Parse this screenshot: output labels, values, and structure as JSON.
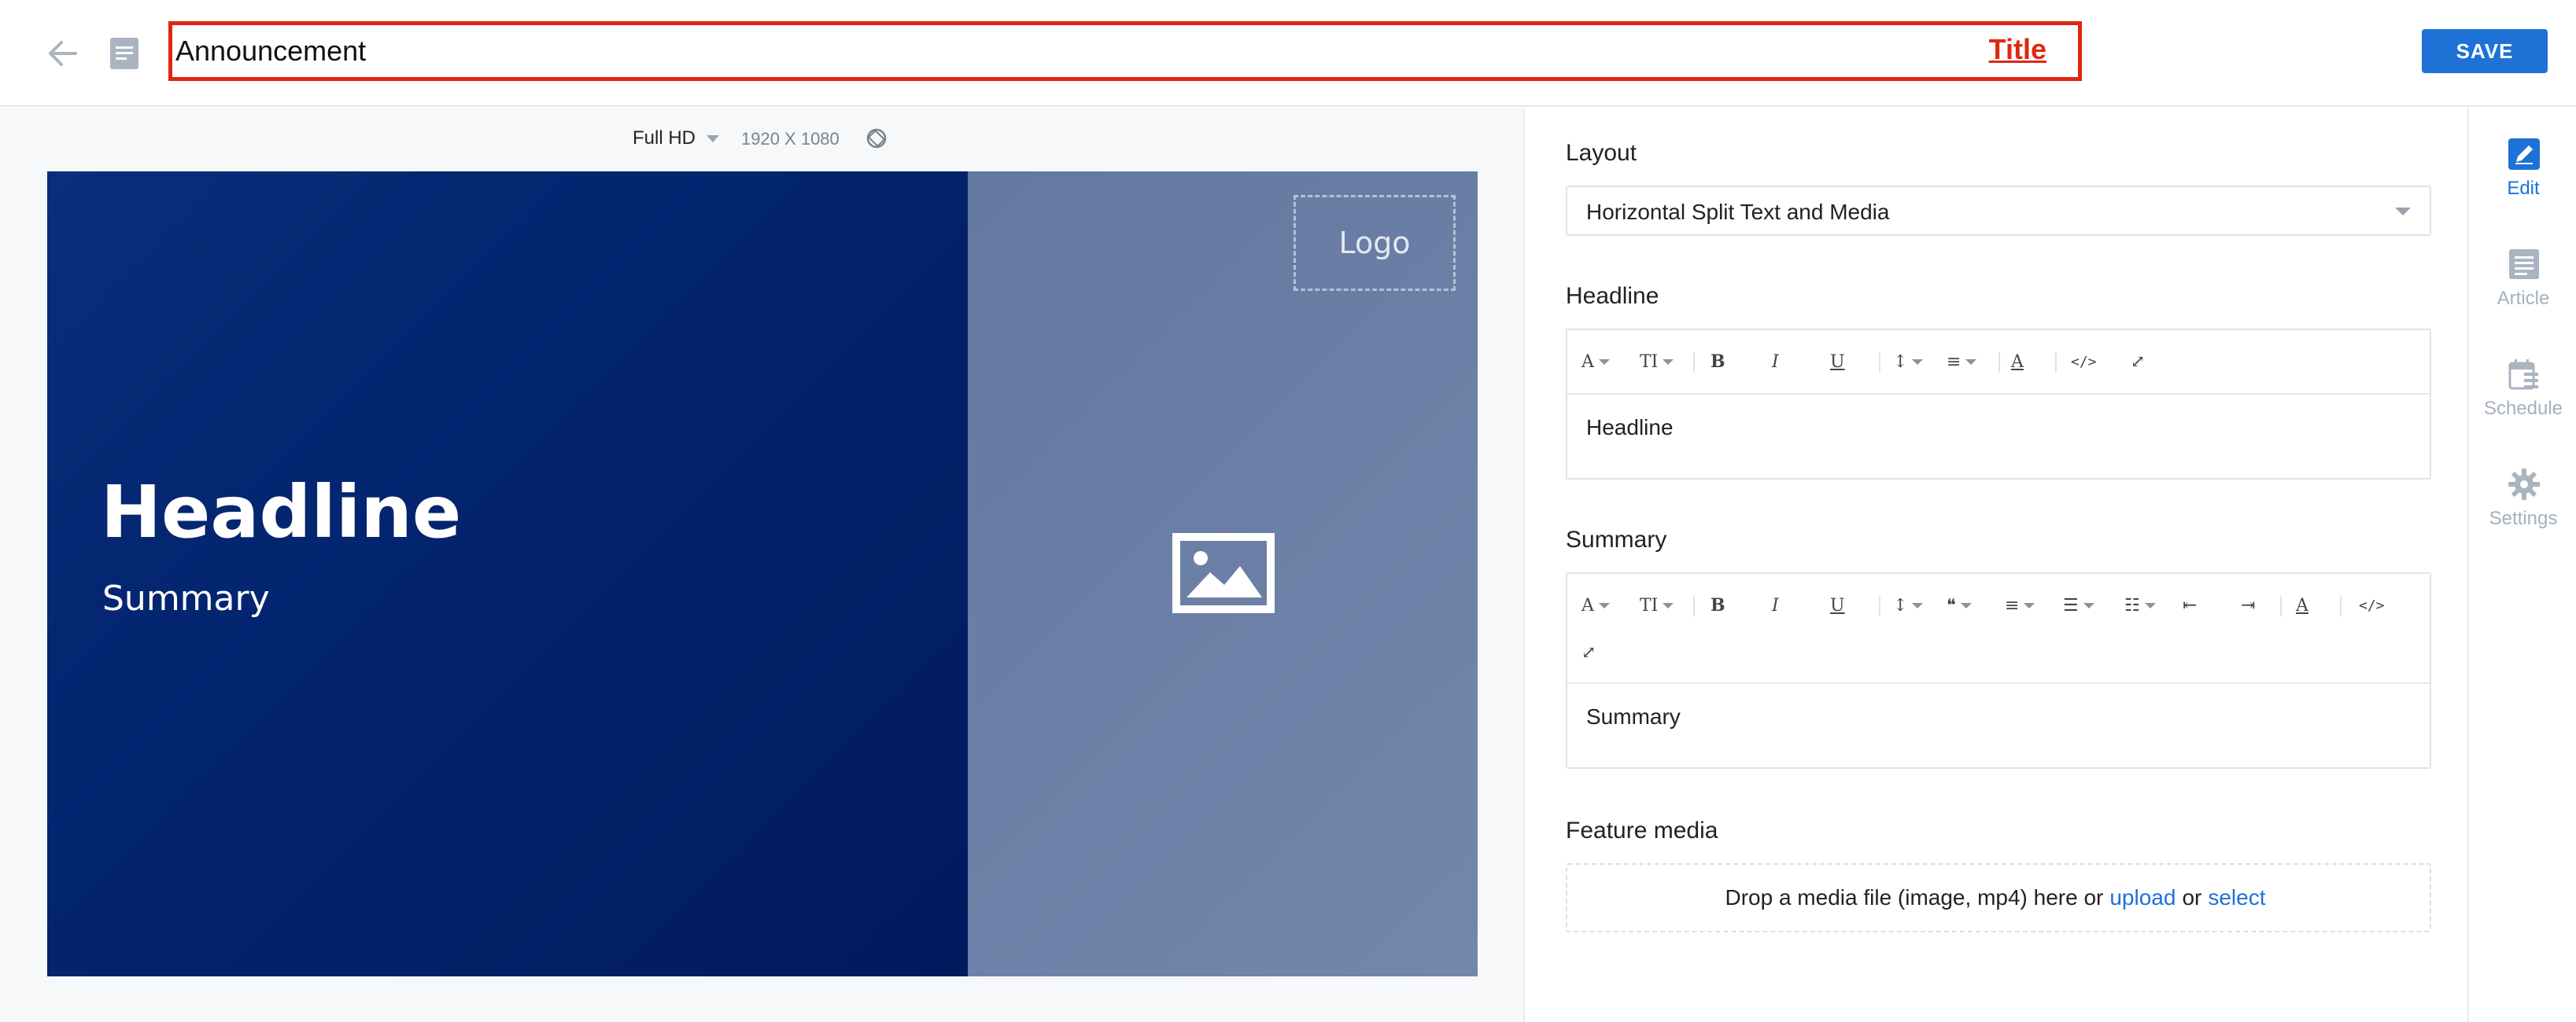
{
  "header": {
    "title_value": "Announcement",
    "title_tag": "Title",
    "save_label": "SAVE"
  },
  "preview": {
    "preset": "Full HD",
    "resolution": "1920 X 1080",
    "slide": {
      "headline": "Headline",
      "summary": "Summary",
      "logo_text": "Logo"
    }
  },
  "panel": {
    "layout": {
      "label": "Layout",
      "value": "Horizontal Split Text and Media"
    },
    "headline": {
      "label": "Headline",
      "content": "Headline"
    },
    "summary": {
      "label": "Summary",
      "content": "Summary"
    },
    "feature_media": {
      "label": "Feature media",
      "text_before": "Drop a media file (image, mp4) here or",
      "upload_link": "upload",
      "or": "or",
      "select_link": "select"
    }
  },
  "side_nav": {
    "items": [
      {
        "label": "Edit",
        "icon": "pencil-icon",
        "active": true
      },
      {
        "label": "Article",
        "icon": "article-icon",
        "active": false
      },
      {
        "label": "Schedule",
        "icon": "schedule-icon",
        "active": false
      },
      {
        "label": "Settings",
        "icon": "gear-icon",
        "active": false
      }
    ]
  },
  "colors": {
    "accent": "#1e72d6",
    "title_highlight": "#e2260f",
    "slide_left": "#03246f",
    "slide_right": "#6c7fa6"
  }
}
